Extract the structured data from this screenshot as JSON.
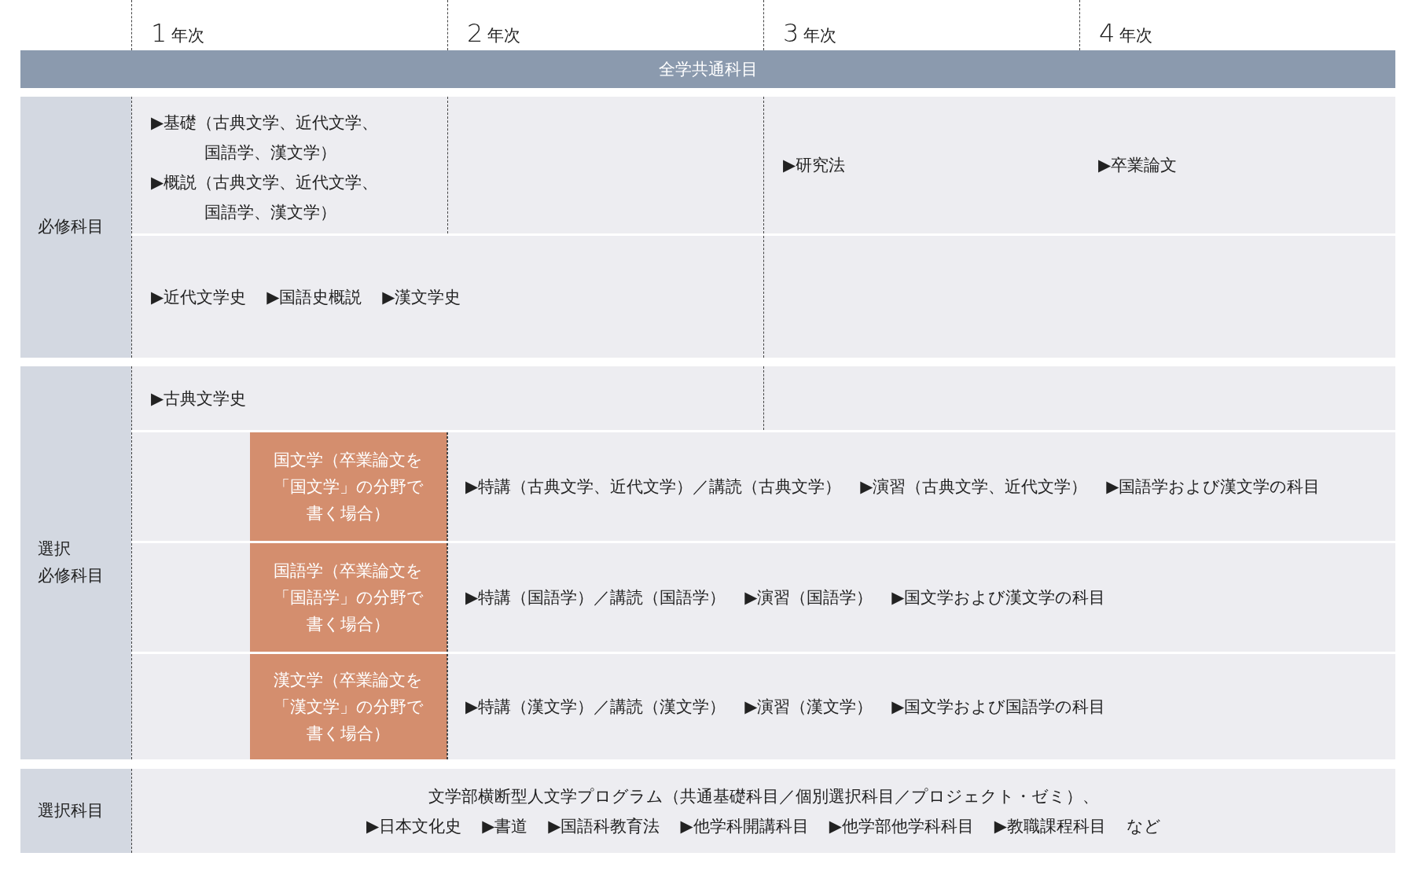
{
  "years": [
    {
      "number": "1",
      "label": "年次"
    },
    {
      "number": "2",
      "label": "年次"
    },
    {
      "number": "3",
      "label": "年次"
    },
    {
      "number": "4",
      "label": "年次"
    }
  ],
  "banner": "全学共通科目",
  "required": {
    "label": "必修科目",
    "year1_items": [
      {
        "lines": [
          "▶基礎（古典文学、近代文学、",
          "国語学、漢文学）"
        ]
      },
      {
        "lines": [
          "▶概説（古典文学、近代文学、",
          "国語学、漢文学）"
        ]
      }
    ],
    "year3_items": [
      "▶研究法"
    ],
    "year4_items": [
      "▶卒業論文"
    ],
    "lower_items": [
      "▶近代文学史",
      "▶国語史概説",
      "▶漢文学史"
    ]
  },
  "elective_required": {
    "label": [
      "選択",
      "必修科目"
    ],
    "top_items": [
      "▶古典文学史"
    ],
    "tracks": [
      {
        "lines": [
          "国文学（卒業論文を",
          "「国文学」の分野で",
          "書く場合）"
        ],
        "items": [
          "▶特講（古典文学、近代文学）／講読（古典文学）",
          "▶演習（古典文学、近代文学）",
          "▶国語学および漢文学の科目"
        ]
      },
      {
        "lines": [
          "国語学（卒業論文を",
          "「国語学」の分野で",
          "書く場合）"
        ],
        "items": [
          "▶特講（国語学）／講読（国語学）",
          "▶演習（国語学）",
          "▶国文学および漢文学の科目"
        ]
      },
      {
        "lines": [
          "漢文学（卒業論文を",
          "「漢文学」の分野で",
          "書く場合）"
        ],
        "items": [
          "▶特講（漢文学）／講読（漢文学）",
          "▶演習（漢文学）",
          "▶国文学および国語学の科目"
        ]
      }
    ]
  },
  "electives": {
    "label": "選択科目",
    "intro": "文学部横断型人文学プログラム（共通基礎科目／個別選択科目／プロジェクト・ゼミ）、",
    "items": [
      "▶日本文化史",
      "▶書道",
      "▶国語科教育法",
      "▶他学科開講科目",
      "▶他学部他学科科目",
      "▶教職課程科目",
      "など"
    ]
  }
}
